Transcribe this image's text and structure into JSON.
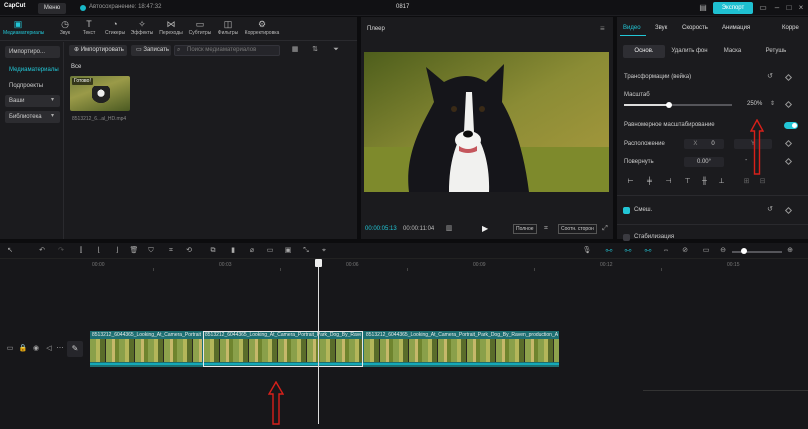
{
  "app": {
    "logo": "CapCut",
    "menu_label": "Меню",
    "autosave": "Автосохранение: 18:47:32",
    "project_title": "0817",
    "export_label": "Экспорт"
  },
  "media_toolbar": {
    "tools": [
      {
        "label": "Медиаматериалы",
        "icon": "media-icon"
      },
      {
        "label": "Звук",
        "icon": "audio-icon"
      },
      {
        "label": "Текст",
        "icon": "text-icon"
      },
      {
        "label": "Стикеры",
        "icon": "sticker-icon"
      },
      {
        "label": "Эффекты",
        "icon": "effects-icon"
      },
      {
        "label": "Переходы",
        "icon": "transitions-icon"
      },
      {
        "label": "Субтитры",
        "icon": "captions-icon"
      },
      {
        "label": "Фильтры",
        "icon": "filters-icon"
      },
      {
        "label": "Корректировка",
        "icon": "adjust-icon"
      }
    ]
  },
  "side_nav": {
    "items": [
      "Импортиро...",
      "Медиаматериалы",
      "Подпроекты",
      "Ваши",
      "Библиотека"
    ]
  },
  "media": {
    "import_label": "Импортировать",
    "record_label": "Записать",
    "search_placeholder": "Поиск медиаматериалов",
    "section_label": "Все",
    "thumb_badge": "Готово!",
    "thumb_name": "8513212_6...al_HD.mp4"
  },
  "player": {
    "title": "Плеер",
    "time_current": "00:00:05:13",
    "time_duration": "00:00:11:04",
    "full_label": "Полное",
    "ratio_label": "Соотн. сторон"
  },
  "right_panel": {
    "tabs": [
      "Видео",
      "Звук",
      "Скорость",
      "Анимация",
      "Корре"
    ],
    "subtabs": [
      "Основ.",
      "Удалить фон",
      "Маска",
      "Ретушь"
    ],
    "transform_label": "Трансформации (вейка)",
    "scale_label": "Масштаб",
    "scale_value": "250%",
    "scale_fraction": 0.42,
    "uniform_label": "Равномерное масштабирование",
    "position_label": "Расположение",
    "position_x_label": "X",
    "position_x": "0",
    "position_y_label": "Y",
    "rotate_label": "Повернуть",
    "rotate_value": "0.00°",
    "blend_label": "Смеш.",
    "stabilize_label": "Стабилизация"
  },
  "timeline": {
    "ruler": [
      "00:00",
      "00:03",
      "00:06",
      "00:09",
      "00:12",
      "00:15"
    ],
    "clip_labels": [
      "8513212_6044365_Looking_At_Camera_Portrait",
      "8513212_6044365_Looking_At_Camera_Portrait_Park_Dog_By_Raven",
      "8513212_6044365_Looking_At_Camera_Portrait_Park_Dog_By_Raven_production_Arti"
    ]
  },
  "colors": {
    "accent": "#22c6d6",
    "annotation_arrow": "#d8201a"
  }
}
